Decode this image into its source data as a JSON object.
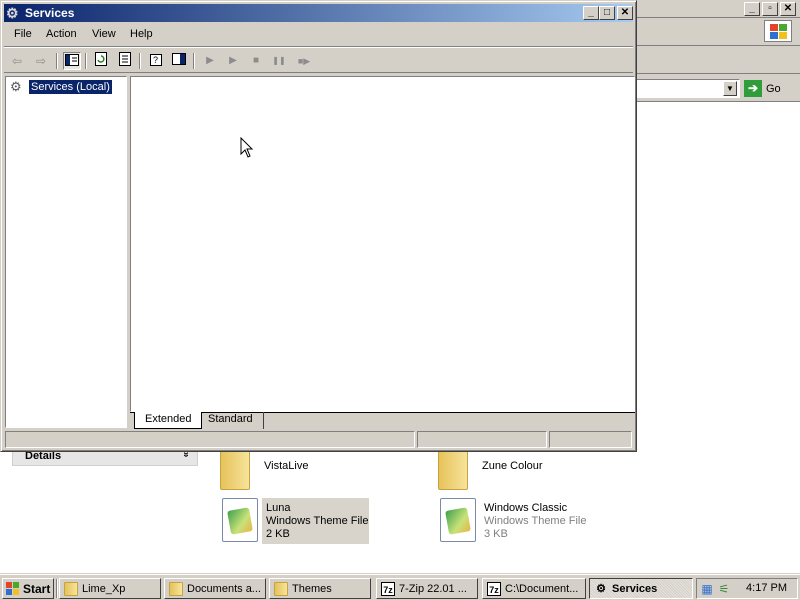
{
  "services_window": {
    "title": "Services",
    "minimize": "_",
    "maximize": "□",
    "close": "✕",
    "menu": [
      "File",
      "Action",
      "View",
      "Help"
    ],
    "tree": {
      "root_label": "Services (Local)"
    },
    "tabs": [
      "Extended",
      "Standard"
    ]
  },
  "toolbar": {
    "back": "⇦",
    "forward": "⇨",
    "start_service": "▶",
    "pause_service": "❚❚",
    "stop_service": "■"
  },
  "background_explorer": {
    "address_go": "Go",
    "details_label": "Details",
    "details_chevron": "»",
    "files": [
      {
        "name": "VistaLive",
        "type": "",
        "size": ""
      },
      {
        "name": "Zune Colour",
        "type": "",
        "size": ""
      },
      {
        "name": "Luna",
        "type": "Windows Theme File",
        "size": "2 KB"
      },
      {
        "name": "Windows Classic",
        "type": "Windows Theme File",
        "size": "3 KB"
      }
    ]
  },
  "taskbar": {
    "start": "Start",
    "buttons": [
      {
        "label": "Lime_Xp"
      },
      {
        "label": "Documents a..."
      },
      {
        "label": "Themes"
      },
      {
        "label": "7-Zip 22.01 ..."
      },
      {
        "label": "C:\\Document..."
      },
      {
        "label": "Services"
      }
    ],
    "zip_icon_label": "7z",
    "clock": "4:17 PM"
  },
  "colors": {
    "title_gradient_start": "#0a246a",
    "title_gradient_end": "#a6caf0",
    "face": "#d4d0c8",
    "selection": "#0a246a"
  }
}
